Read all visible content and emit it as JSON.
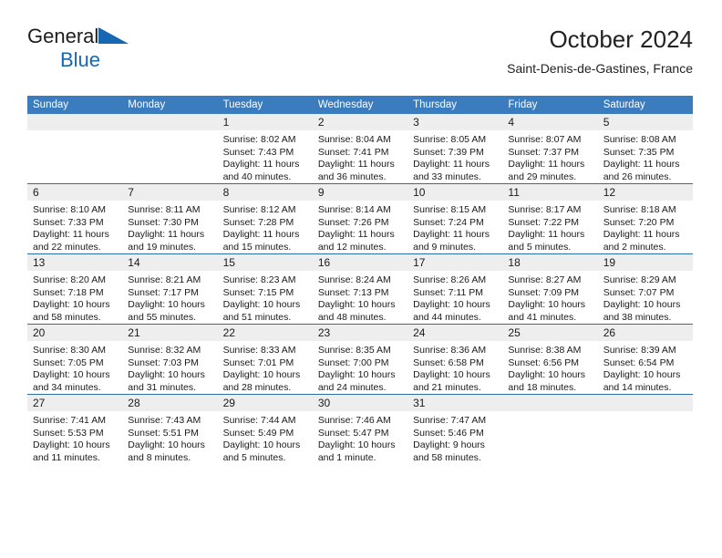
{
  "brand": {
    "name_top": "General",
    "name_bottom": "Blue",
    "triangle_color": "#1668b3"
  },
  "header": {
    "title": "October 2024",
    "subtitle": "Saint-Denis-de-Gastines, France"
  },
  "theme": {
    "header_bg": "#3a7cbe",
    "row_divider": "#2e6da4",
    "daynum_bg": "#eeeeee",
    "text": "#1a1a1a"
  },
  "weekday_headers": [
    "Sunday",
    "Monday",
    "Tuesday",
    "Wednesday",
    "Thursday",
    "Friday",
    "Saturday"
  ],
  "weeks": [
    [
      {
        "day": "",
        "sunrise": "",
        "sunset": "",
        "daylight1": "",
        "daylight2": ""
      },
      {
        "day": "",
        "sunrise": "",
        "sunset": "",
        "daylight1": "",
        "daylight2": ""
      },
      {
        "day": "1",
        "sunrise": "Sunrise: 8:02 AM",
        "sunset": "Sunset: 7:43 PM",
        "daylight1": "Daylight: 11 hours",
        "daylight2": "and 40 minutes."
      },
      {
        "day": "2",
        "sunrise": "Sunrise: 8:04 AM",
        "sunset": "Sunset: 7:41 PM",
        "daylight1": "Daylight: 11 hours",
        "daylight2": "and 36 minutes."
      },
      {
        "day": "3",
        "sunrise": "Sunrise: 8:05 AM",
        "sunset": "Sunset: 7:39 PM",
        "daylight1": "Daylight: 11 hours",
        "daylight2": "and 33 minutes."
      },
      {
        "day": "4",
        "sunrise": "Sunrise: 8:07 AM",
        "sunset": "Sunset: 7:37 PM",
        "daylight1": "Daylight: 11 hours",
        "daylight2": "and 29 minutes."
      },
      {
        "day": "5",
        "sunrise": "Sunrise: 8:08 AM",
        "sunset": "Sunset: 7:35 PM",
        "daylight1": "Daylight: 11 hours",
        "daylight2": "and 26 minutes."
      }
    ],
    [
      {
        "day": "6",
        "sunrise": "Sunrise: 8:10 AM",
        "sunset": "Sunset: 7:33 PM",
        "daylight1": "Daylight: 11 hours",
        "daylight2": "and 22 minutes."
      },
      {
        "day": "7",
        "sunrise": "Sunrise: 8:11 AM",
        "sunset": "Sunset: 7:30 PM",
        "daylight1": "Daylight: 11 hours",
        "daylight2": "and 19 minutes."
      },
      {
        "day": "8",
        "sunrise": "Sunrise: 8:12 AM",
        "sunset": "Sunset: 7:28 PM",
        "daylight1": "Daylight: 11 hours",
        "daylight2": "and 15 minutes."
      },
      {
        "day": "9",
        "sunrise": "Sunrise: 8:14 AM",
        "sunset": "Sunset: 7:26 PM",
        "daylight1": "Daylight: 11 hours",
        "daylight2": "and 12 minutes."
      },
      {
        "day": "10",
        "sunrise": "Sunrise: 8:15 AM",
        "sunset": "Sunset: 7:24 PM",
        "daylight1": "Daylight: 11 hours",
        "daylight2": "and 9 minutes."
      },
      {
        "day": "11",
        "sunrise": "Sunrise: 8:17 AM",
        "sunset": "Sunset: 7:22 PM",
        "daylight1": "Daylight: 11 hours",
        "daylight2": "and 5 minutes."
      },
      {
        "day": "12",
        "sunrise": "Sunrise: 8:18 AM",
        "sunset": "Sunset: 7:20 PM",
        "daylight1": "Daylight: 11 hours",
        "daylight2": "and 2 minutes."
      }
    ],
    [
      {
        "day": "13",
        "sunrise": "Sunrise: 8:20 AM",
        "sunset": "Sunset: 7:18 PM",
        "daylight1": "Daylight: 10 hours",
        "daylight2": "and 58 minutes."
      },
      {
        "day": "14",
        "sunrise": "Sunrise: 8:21 AM",
        "sunset": "Sunset: 7:17 PM",
        "daylight1": "Daylight: 10 hours",
        "daylight2": "and 55 minutes."
      },
      {
        "day": "15",
        "sunrise": "Sunrise: 8:23 AM",
        "sunset": "Sunset: 7:15 PM",
        "daylight1": "Daylight: 10 hours",
        "daylight2": "and 51 minutes."
      },
      {
        "day": "16",
        "sunrise": "Sunrise: 8:24 AM",
        "sunset": "Sunset: 7:13 PM",
        "daylight1": "Daylight: 10 hours",
        "daylight2": "and 48 minutes."
      },
      {
        "day": "17",
        "sunrise": "Sunrise: 8:26 AM",
        "sunset": "Sunset: 7:11 PM",
        "daylight1": "Daylight: 10 hours",
        "daylight2": "and 44 minutes."
      },
      {
        "day": "18",
        "sunrise": "Sunrise: 8:27 AM",
        "sunset": "Sunset: 7:09 PM",
        "daylight1": "Daylight: 10 hours",
        "daylight2": "and 41 minutes."
      },
      {
        "day": "19",
        "sunrise": "Sunrise: 8:29 AM",
        "sunset": "Sunset: 7:07 PM",
        "daylight1": "Daylight: 10 hours",
        "daylight2": "and 38 minutes."
      }
    ],
    [
      {
        "day": "20",
        "sunrise": "Sunrise: 8:30 AM",
        "sunset": "Sunset: 7:05 PM",
        "daylight1": "Daylight: 10 hours",
        "daylight2": "and 34 minutes."
      },
      {
        "day": "21",
        "sunrise": "Sunrise: 8:32 AM",
        "sunset": "Sunset: 7:03 PM",
        "daylight1": "Daylight: 10 hours",
        "daylight2": "and 31 minutes."
      },
      {
        "day": "22",
        "sunrise": "Sunrise: 8:33 AM",
        "sunset": "Sunset: 7:01 PM",
        "daylight1": "Daylight: 10 hours",
        "daylight2": "and 28 minutes."
      },
      {
        "day": "23",
        "sunrise": "Sunrise: 8:35 AM",
        "sunset": "Sunset: 7:00 PM",
        "daylight1": "Daylight: 10 hours",
        "daylight2": "and 24 minutes."
      },
      {
        "day": "24",
        "sunrise": "Sunrise: 8:36 AM",
        "sunset": "Sunset: 6:58 PM",
        "daylight1": "Daylight: 10 hours",
        "daylight2": "and 21 minutes."
      },
      {
        "day": "25",
        "sunrise": "Sunrise: 8:38 AM",
        "sunset": "Sunset: 6:56 PM",
        "daylight1": "Daylight: 10 hours",
        "daylight2": "and 18 minutes."
      },
      {
        "day": "26",
        "sunrise": "Sunrise: 8:39 AM",
        "sunset": "Sunset: 6:54 PM",
        "daylight1": "Daylight: 10 hours",
        "daylight2": "and 14 minutes."
      }
    ],
    [
      {
        "day": "27",
        "sunrise": "Sunrise: 7:41 AM",
        "sunset": "Sunset: 5:53 PM",
        "daylight1": "Daylight: 10 hours",
        "daylight2": "and 11 minutes."
      },
      {
        "day": "28",
        "sunrise": "Sunrise: 7:43 AM",
        "sunset": "Sunset: 5:51 PM",
        "daylight1": "Daylight: 10 hours",
        "daylight2": "and 8 minutes."
      },
      {
        "day": "29",
        "sunrise": "Sunrise: 7:44 AM",
        "sunset": "Sunset: 5:49 PM",
        "daylight1": "Daylight: 10 hours",
        "daylight2": "and 5 minutes."
      },
      {
        "day": "30",
        "sunrise": "Sunrise: 7:46 AM",
        "sunset": "Sunset: 5:47 PM",
        "daylight1": "Daylight: 10 hours",
        "daylight2": "and 1 minute."
      },
      {
        "day": "31",
        "sunrise": "Sunrise: 7:47 AM",
        "sunset": "Sunset: 5:46 PM",
        "daylight1": "Daylight: 9 hours",
        "daylight2": "and 58 minutes."
      },
      {
        "day": "",
        "sunrise": "",
        "sunset": "",
        "daylight1": "",
        "daylight2": ""
      },
      {
        "day": "",
        "sunrise": "",
        "sunset": "",
        "daylight1": "",
        "daylight2": ""
      }
    ]
  ]
}
